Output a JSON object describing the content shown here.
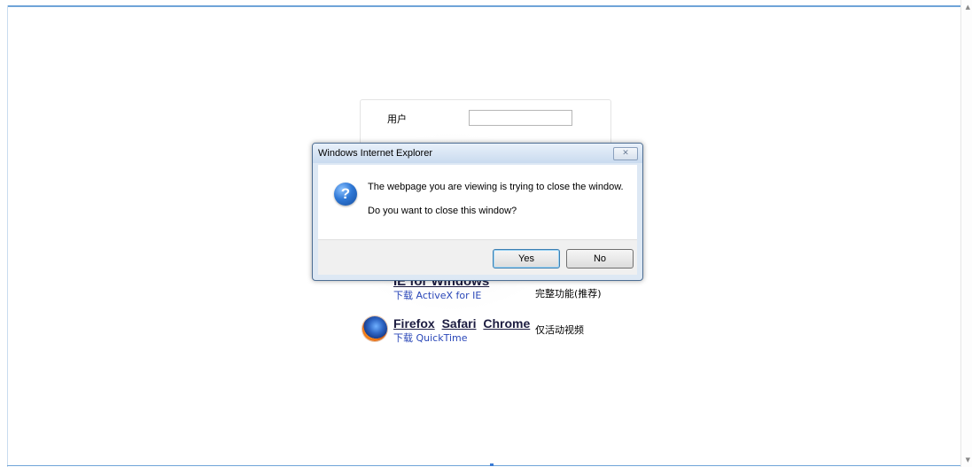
{
  "page": {
    "login": {
      "user_label": "用户"
    },
    "ie": {
      "title": "IE for Windows",
      "download_prefix": "下载",
      "download_link": "ActiveX for IE",
      "note": "完整功能(推荐)"
    },
    "other_browsers": {
      "links": [
        "Firefox",
        "Safari",
        "Chrome"
      ],
      "download_prefix": "下载",
      "download_link": "QuickTime",
      "note": "仅活动视频"
    }
  },
  "dialog": {
    "title": "Windows Internet Explorer",
    "close_glyph": "✕",
    "message_line1": "The webpage you are viewing is trying to close the window.",
    "message_line2": "Do you want to close this window?",
    "yes_label": "Yes",
    "no_label": "No",
    "icon": "question-icon"
  }
}
